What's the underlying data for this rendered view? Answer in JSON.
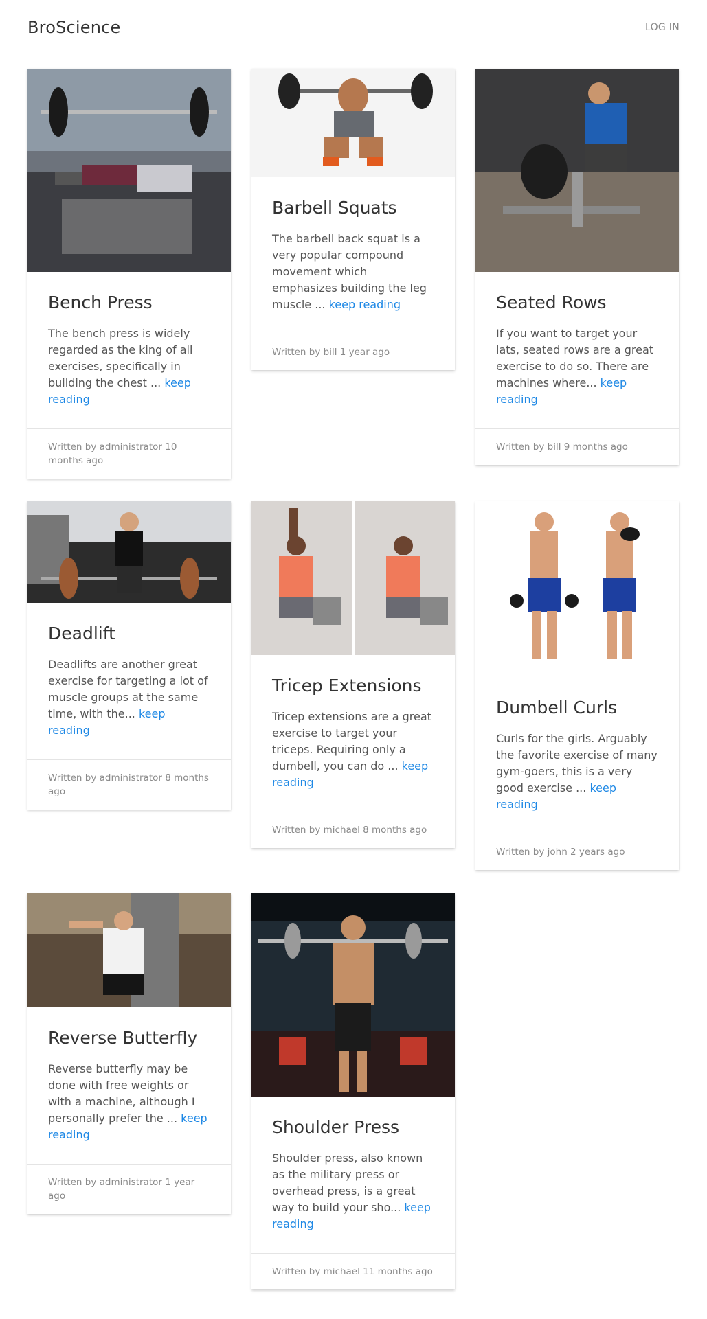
{
  "header": {
    "brand": "BroScience",
    "login": "LOG IN"
  },
  "posts": [
    {
      "title": "Bench Press",
      "excerpt": "The bench press is widely regarded as the king of all exercises, specifically in building the chest ...",
      "link": "keep reading",
      "footer": "Written by administrator 10 months ago",
      "image": "bench-press-photo"
    },
    {
      "title": "Barbell Squats",
      "excerpt": "The barbell back squat is a very popular compound movement which emphasizes building the leg muscle ...",
      "link": "keep reading",
      "footer": "Written by bill 1 year ago",
      "image": "barbell-squat-photo"
    },
    {
      "title": "Seated Rows",
      "excerpt": "If you want to target your lats, seated rows are a great exercise to do so. There are machines where...",
      "link": "keep reading",
      "footer": "Written by bill 9 months ago",
      "image": "seated-row-photo"
    },
    {
      "title": "Deadlift",
      "excerpt": "Deadlifts are another great exercise for targeting a lot of muscle groups at the same time, with the...",
      "link": "keep reading",
      "footer": "Written by administrator 8 months ago",
      "image": "deadlift-photo"
    },
    {
      "title": "Tricep Extensions",
      "excerpt": "Tricep extensions are a great exercise to target your triceps. Requiring only a dumbell, you can do ...",
      "link": "keep reading",
      "footer": "Written by michael 8 months ago",
      "image": "tricep-extension-photo"
    },
    {
      "title": "Dumbell Curls",
      "excerpt": "Curls for the girls. Arguably the favorite exercise of many gym-goers, this is a very good exercise ...",
      "link": "keep reading",
      "footer": "Written by john 2 years ago",
      "image": "dumbbell-curl-photo"
    },
    {
      "title": "Reverse Butterfly",
      "excerpt": "Reverse butterfly may be done with free weights or with a machine, although I personally prefer the ...",
      "link": "keep reading",
      "footer": "Written by administrator 1 year ago",
      "image": "reverse-butterfly-photo"
    },
    {
      "title": "Shoulder Press",
      "excerpt": "Shoulder press, also known as the military press or overhead press, is a great way to build your sho...",
      "link": "keep reading",
      "footer": "Written by michael 11 months ago",
      "image": "shoulder-press-photo"
    }
  ],
  "colors": {
    "link": "#1e88e5",
    "footer_text": "#8a8a8a",
    "body_text": "#555555"
  }
}
